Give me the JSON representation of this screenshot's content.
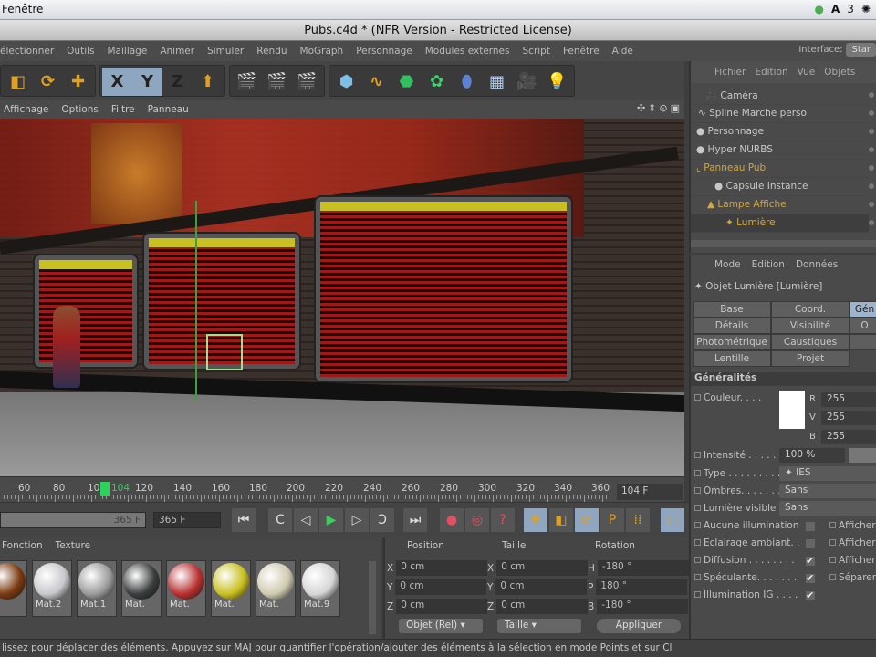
{
  "os_menu": {
    "label": "Fenêtre",
    "badge": "3"
  },
  "window": {
    "title": "Pubs.c4d * (NFR Version - Restricted License)"
  },
  "menu": [
    "électionner",
    "Outils",
    "Maillage",
    "Animer",
    "Simuler",
    "Rendu",
    "MoGraph",
    "Personnage",
    "Modules externes",
    "Script",
    "Fenêtre",
    "Aide"
  ],
  "interface": {
    "label": "Interface:",
    "value": "Star"
  },
  "toolbar": [
    {
      "icon": "scale-icon",
      "glyph": "◧"
    },
    {
      "icon": "rotate-icon",
      "glyph": "⟳"
    },
    {
      "icon": "move-icon",
      "glyph": "✚"
    },
    {
      "icon": "x-axis-icon",
      "glyph": "X"
    },
    {
      "icon": "y-axis-icon",
      "glyph": "Y"
    },
    {
      "icon": "z-axis-icon",
      "glyph": "Z"
    },
    {
      "icon": "coordinate-system-icon",
      "glyph": "⬆"
    },
    {
      "icon": "render-view-icon",
      "glyph": "🎬"
    },
    {
      "icon": "render-picture-icon",
      "glyph": "🎬"
    },
    {
      "icon": "render-settings-icon",
      "glyph": "🎬"
    },
    {
      "icon": "cube-icon",
      "glyph": "⬢"
    },
    {
      "icon": "spline-icon",
      "glyph": "∿"
    },
    {
      "icon": "nurbs-icon",
      "glyph": "⬣"
    },
    {
      "icon": "array-icon",
      "glyph": "✿"
    },
    {
      "icon": "deformer-icon",
      "glyph": "⬮"
    },
    {
      "icon": "floor-icon",
      "glyph": "▦"
    },
    {
      "icon": "camera-icon",
      "glyph": "🎥"
    },
    {
      "icon": "light-icon",
      "glyph": "💡"
    }
  ],
  "viewport": {
    "menu": [
      "Affichage",
      "Options",
      "Filtre",
      "Panneau"
    ]
  },
  "timeline": {
    "ticks": [
      "60",
      "80",
      "10",
      "104",
      "120",
      "140",
      "160",
      "180",
      "200",
      "220",
      "240",
      "260",
      "280",
      "300",
      "320",
      "340",
      "360"
    ],
    "current_frame": "104 F",
    "end_frame_slider": "365 F",
    "end_frame": "365 F"
  },
  "materials": {
    "menu": [
      "Fonction",
      "Texture"
    ],
    "items": [
      {
        "name": ".3",
        "color": "#7a3a10"
      },
      {
        "name": "Mat.2",
        "color": "#c8c8cc"
      },
      {
        "name": "Mat.1",
        "color": "#9a9a9a"
      },
      {
        "name": "Mat.",
        "color": "#3a3d3d"
      },
      {
        "name": "Mat.",
        "color": "#b83030"
      },
      {
        "name": "Mat.",
        "color": "#c8c020"
      },
      {
        "name": "Mat.",
        "color": "#cfcab0"
      },
      {
        "name": "Mat.9",
        "color": "#d6d6d6"
      }
    ]
  },
  "coords": {
    "headers": [
      "Position",
      "Taille",
      "Rotation"
    ],
    "rows": [
      {
        "a": "X",
        "pos": "0 cm",
        "b": "X",
        "size": "0 cm",
        "c": "H",
        "rot": "-180 °"
      },
      {
        "a": "Y",
        "pos": "0 cm",
        "b": "Y",
        "size": "0 cm",
        "c": "P",
        "rot": "180 °"
      },
      {
        "a": "Z",
        "pos": "0 cm",
        "b": "Z",
        "size": "0 cm",
        "c": "B",
        "rot": "-180 °"
      }
    ],
    "mode": "Objet (Rel)",
    "size_mode": "Taille",
    "apply": "Appliquer"
  },
  "status": "lissez pour déplacer des éléments. Appuyez sur MAJ pour quantifier l'opération/ajouter des éléments à la sélection en mode Points et sur Cl",
  "objects": {
    "menu": [
      "Fichier",
      "Edition",
      "Vue",
      "Objets"
    ],
    "items": [
      {
        "name": "Caméra",
        "highlight": false
      },
      {
        "name": "Spline Marche perso",
        "highlight": false
      },
      {
        "name": "Personnage",
        "highlight": false
      },
      {
        "name": "Hyper NURBS",
        "highlight": false
      },
      {
        "name": "Panneau Pub",
        "highlight": true
      },
      {
        "name": "Capsule Instance",
        "highlight": false
      },
      {
        "name": "Lampe Affiche",
        "highlight": true
      },
      {
        "name": "Lumière",
        "highlight": true
      }
    ]
  },
  "attributes": {
    "menu": [
      "Mode",
      "Edition",
      "Données"
    ],
    "object": "Objet Lumière [Lumière]",
    "tabs": [
      "Base",
      "Coord.",
      "Gén",
      "Détails",
      "Visibilité",
      "O",
      "Photométrique",
      "Caustiques",
      "",
      "Lentille",
      "Projet"
    ],
    "section": "Généralités",
    "color_label": "Couleur. . . .",
    "r_label": "R",
    "r": "255",
    "g_label": "V",
    "g": "255",
    "b_label": "B",
    "b": "255",
    "intensity_label": "Intensité . . . . . .",
    "intensity": "100 %",
    "type_label": "Type . . . . . . . . .",
    "type": "IES",
    "shadows_label": "Ombres. . . . . . . .",
    "shadows": "Sans",
    "visible_label": "Lumière visible",
    "visible": "Sans",
    "checks": [
      {
        "label": "Aucune illumination",
        "checked": false,
        "right": "Afficher"
      },
      {
        "label": "Eclairage ambiant. .",
        "checked": false,
        "right": "Afficher"
      },
      {
        "label": "Diffusion . . . . . . . .",
        "checked": true,
        "right": "Afficher"
      },
      {
        "label": "Spéculante. . . . . . .",
        "checked": true,
        "right": "Séparer"
      },
      {
        "label": "Illumination IG . . . .",
        "checked": true,
        "right": ""
      }
    ]
  }
}
